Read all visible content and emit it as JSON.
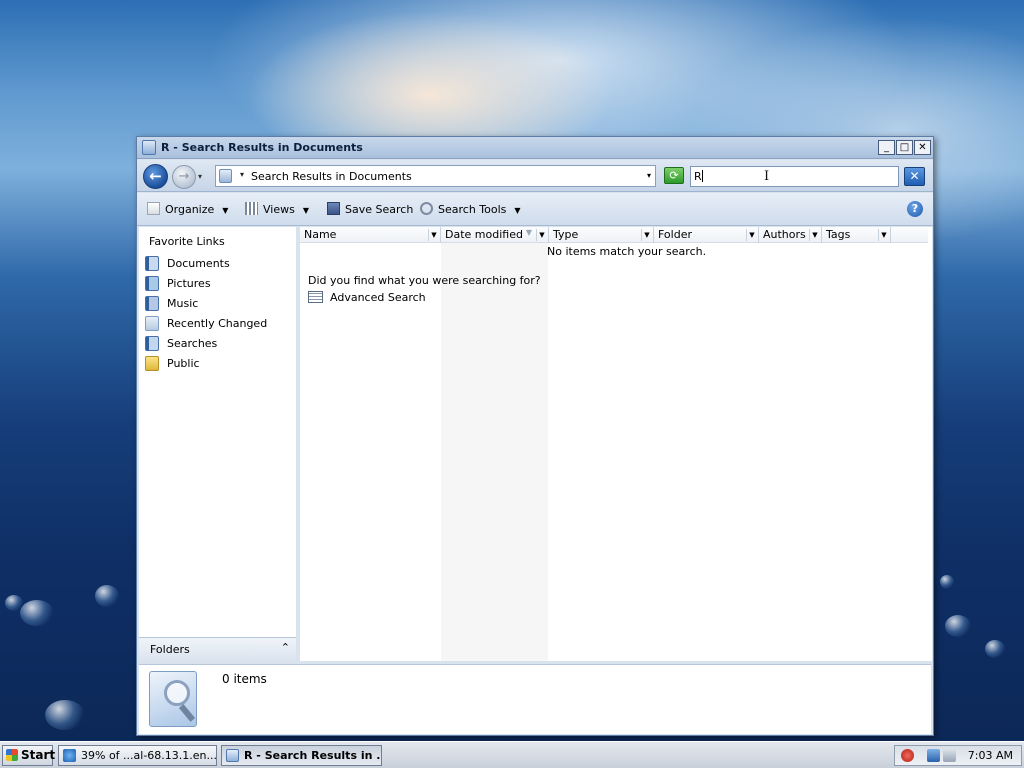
{
  "window": {
    "title": "R - Search Results in Documents",
    "buttons": {
      "minimize": "_",
      "maximize": "□",
      "close": "✕"
    }
  },
  "address": {
    "back": "←",
    "forward": "→",
    "path": "Search Results in Documents",
    "refresh_icon": "refresh-icon"
  },
  "search": {
    "value": "R"
  },
  "toolbar": {
    "organize": "Organize",
    "views": "Views",
    "save_search": "Save Search",
    "search_tools": "Search Tools",
    "help": "?"
  },
  "favorites": {
    "title": "Favorite Links",
    "items": [
      {
        "label": "Documents",
        "icon": "documents-icon"
      },
      {
        "label": "Pictures",
        "icon": "pictures-icon"
      },
      {
        "label": "Music",
        "icon": "music-icon"
      },
      {
        "label": "Recently Changed",
        "icon": "recently-changed-icon"
      },
      {
        "label": "Searches",
        "icon": "searches-icon"
      },
      {
        "label": "Public",
        "icon": "public-folder-icon"
      }
    ]
  },
  "folders": {
    "label": "Folders",
    "chevron": "⌃"
  },
  "columns": [
    "Name",
    "Date modified",
    "Type",
    "Folder",
    "Authors",
    "Tags"
  ],
  "results": {
    "empty_message": "No items match your search.",
    "prompt": "Did you find what you were searching for?",
    "advanced_search": "Advanced Search"
  },
  "details": {
    "count": "0 items"
  },
  "taskbar": {
    "start": "Start",
    "tasks": [
      {
        "label": "39% of ...al-68.13.1.en...",
        "active": false
      },
      {
        "label": "R - Search Results in ...",
        "active": true
      }
    ],
    "clock": "7:03 AM"
  },
  "colors": {
    "titlebar": "#a9c0dd",
    "accent": "#1f5eb4",
    "refresh": "#2d9a2a"
  }
}
